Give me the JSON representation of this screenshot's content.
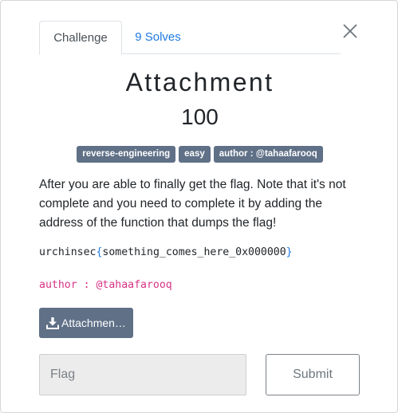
{
  "tabs": [
    {
      "label": "Challenge",
      "active": true
    },
    {
      "label": "9 Solves",
      "active": false
    }
  ],
  "challenge": {
    "name": "Attachment",
    "points": "100",
    "tags": [
      "reverse-engineering",
      "easy",
      "author : @tahaafarooq"
    ],
    "description": "After you are able to finally get the flag. Note that it's not complete and you need to complete it by adding the address of the function that dumps the flag!",
    "flag_prefix": "urchinsec",
    "flag_open": "{",
    "flag_body": "something_comes_here_0x000000",
    "flag_close": "}",
    "author_line": "author : @tahaafarooq"
  },
  "attachment": {
    "label": "Attachmen…",
    "icon": "download-icon"
  },
  "form": {
    "flag_placeholder": "Flag",
    "flag_value": "",
    "submit_label": "Submit"
  },
  "colors": {
    "tag_bg": "#5f7087",
    "link": "#1f7ae0",
    "author": "#d63384"
  }
}
